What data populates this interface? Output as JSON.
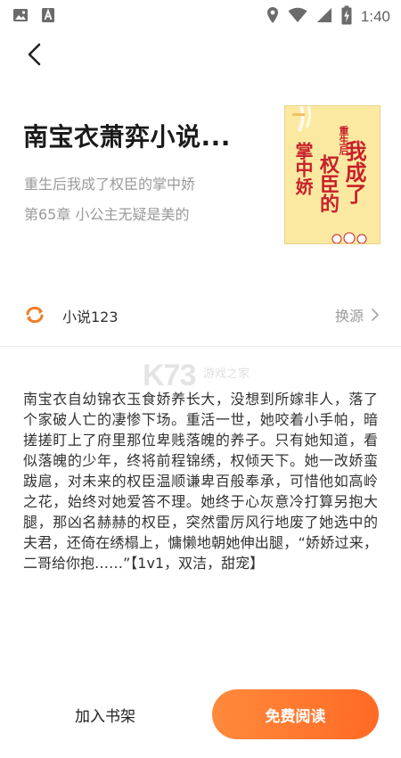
{
  "status_bar": {
    "time": "1:40",
    "left_icons": [
      "image-icon",
      "a-letter-icon"
    ],
    "right_icons": [
      "location-icon",
      "wifi-icon",
      "cell-signal-icon",
      "battery-charging-icon"
    ]
  },
  "book": {
    "title": "南宝衣萧弈小说...",
    "author": "重生后我成了权臣的掌中娇",
    "chapter": "第65章 小公主无疑是美的",
    "cover": {
      "text_line1": "权臣的",
      "text_line2": "掌中娇",
      "text_line3": "我成了",
      "subtitle": "重生后",
      "color_bg": "#fbe9a2",
      "color_text": "#c8202a"
    }
  },
  "source": {
    "name": "小说123",
    "switch_label": "换源"
  },
  "watermark": {
    "brand": "K73",
    "site": "游戏之家"
  },
  "synopsis": "南宝衣自幼锦衣玉食娇养长大，没想到所嫁非人，落了个家破人亡的凄惨下场。重活一世，她咬着小手帕，暗搓搓盯上了府里那位卑贱落魄的养子。只有她知道，看似落魄的少年，终将前程锦绣，权倾天下。她一改娇蛮跋扈，对未来的权臣温顺谦卑百般奉承，可惜他如高岭之花，始终对她爱答不理。她终于心灰意冷打算另抱大腿，那凶名赫赫的权臣，突然雷厉风行地废了她选中的夫君，还倚在绣榻上，慵懒地朝她伸出腿，“娇娇过来，二哥给你抱……”【1v1，双洁，甜宠】",
  "actions": {
    "add_shelf": "加入书架",
    "read_free": "免费阅读"
  },
  "colors": {
    "accent": "#ff6a24",
    "muted_text": "#9a9a9a",
    "source_icon": "#f07c2a"
  }
}
